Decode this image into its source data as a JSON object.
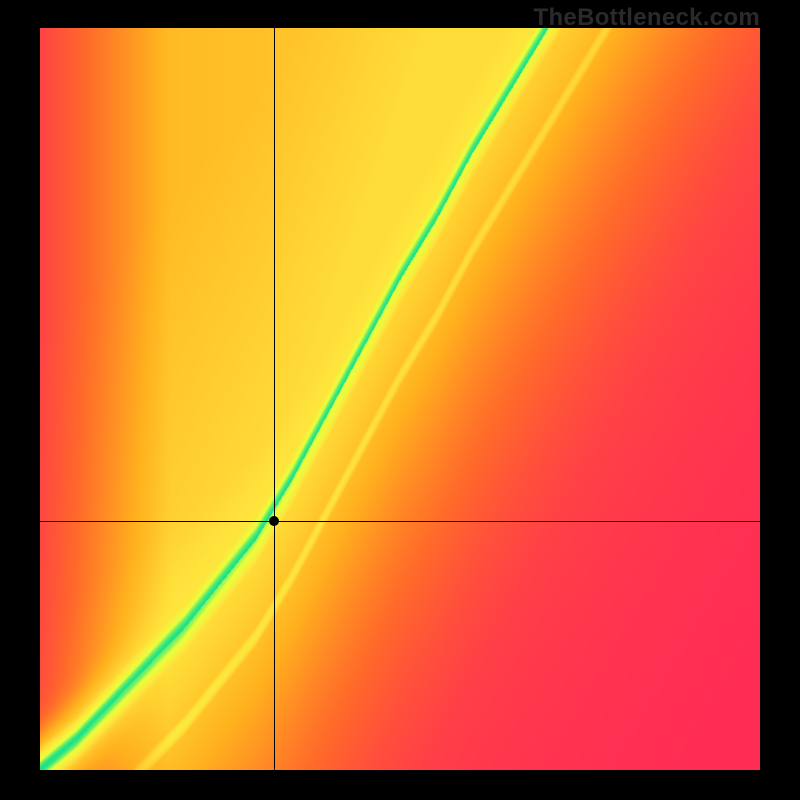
{
  "watermark": "TheBottleneck.com",
  "chart_data": {
    "type": "heatmap",
    "title": "",
    "xlabel": "",
    "ylabel": "",
    "xlim": [
      0,
      1
    ],
    "ylim": [
      0,
      1
    ],
    "grid": false,
    "legend": false,
    "point": {
      "x": 0.325,
      "y": 0.335
    },
    "crosshair": {
      "x": 0.325,
      "y": 0.335
    },
    "optimal_ridge": {
      "description": "green optimal band; y as a function of x (normalized 0-1)",
      "x": [
        0.0,
        0.05,
        0.1,
        0.15,
        0.2,
        0.25,
        0.3,
        0.35,
        0.4,
        0.45,
        0.5,
        0.55,
        0.6,
        0.65,
        0.7,
        0.75,
        0.8,
        0.85,
        0.9,
        0.95,
        1.0
      ],
      "y": [
        0.0,
        0.04,
        0.09,
        0.14,
        0.19,
        0.25,
        0.31,
        0.39,
        0.48,
        0.57,
        0.66,
        0.74,
        0.83,
        0.91,
        0.99,
        1.07,
        1.15,
        1.23,
        1.31,
        1.39,
        1.47
      ],
      "band_halfwidth": 0.045
    },
    "secondary_ridge": {
      "description": "faint yellow secondary band below main ridge",
      "offset_y": -0.13,
      "band_halfwidth": 0.02
    },
    "colormap": {
      "stops": [
        {
          "t": 0.0,
          "color": "#ff2a55"
        },
        {
          "t": 0.25,
          "color": "#ff6a2a"
        },
        {
          "t": 0.5,
          "color": "#ffb21e"
        },
        {
          "t": 0.75,
          "color": "#ffe33c"
        },
        {
          "t": 0.92,
          "color": "#eaff3c"
        },
        {
          "t": 1.0,
          "color": "#17e28a"
        }
      ]
    }
  }
}
